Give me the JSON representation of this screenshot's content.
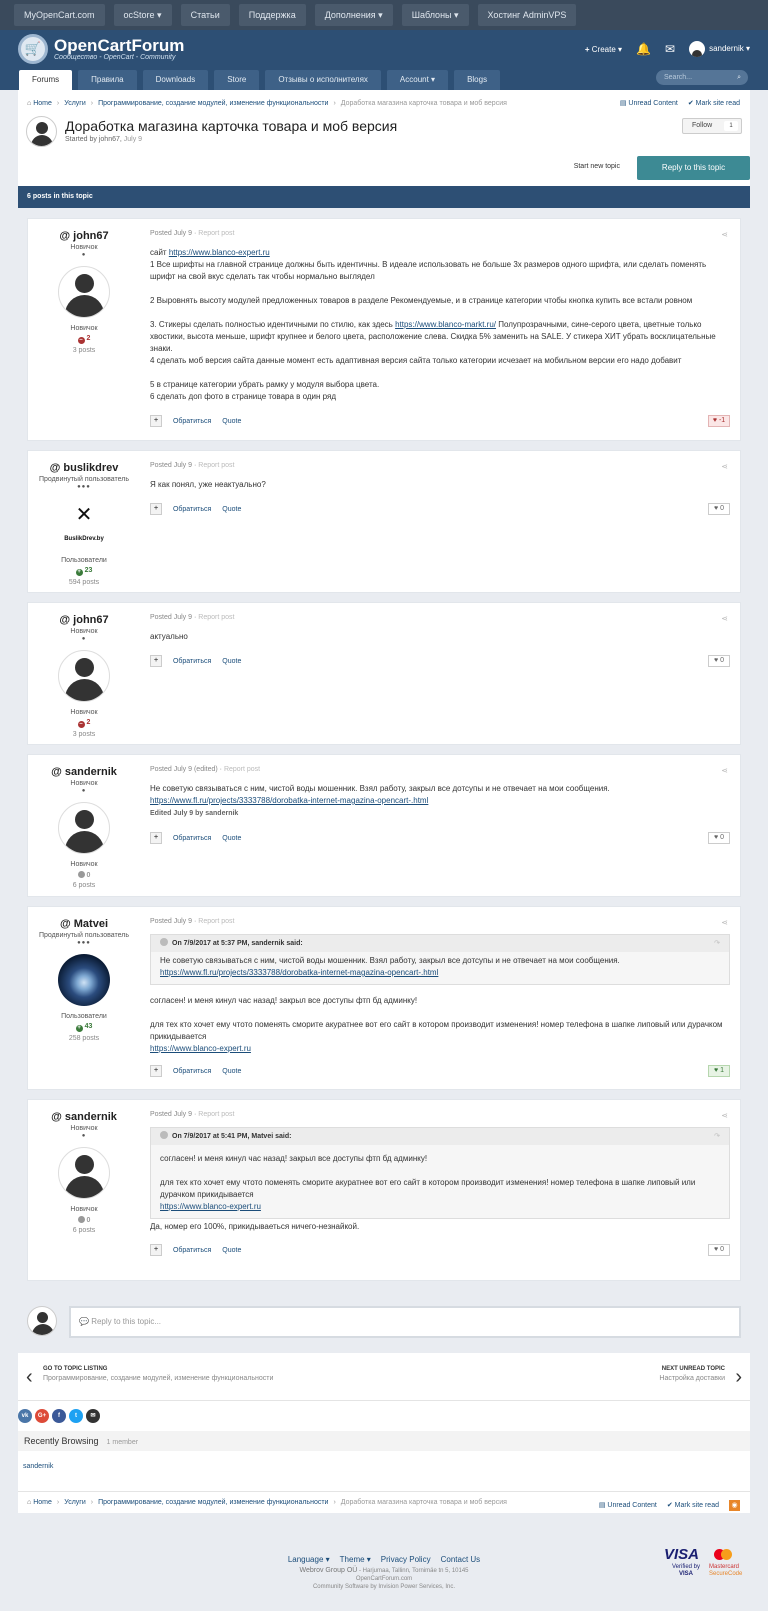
{
  "topnav": [
    "MyOpenCart.com",
    "ocStore ▾",
    "Статьи",
    "Поддержка",
    "Дополнения ▾",
    "Шаблоны ▾",
    "Хостинг AdminVPS"
  ],
  "brand": {
    "name": "OpenCartForum",
    "tagline": "Сообщество - OpenCart - Community"
  },
  "header": {
    "create": "Create",
    "user": "sandernik"
  },
  "mainnav": [
    "Forums",
    "Правила",
    "Downloads",
    "Store",
    "Отзывы о исполнителях",
    "Account ▾",
    "Blogs"
  ],
  "search": {
    "placeholder": "Search..."
  },
  "breadcrumb": {
    "home": "Home",
    "items": [
      "Услуги",
      "Программирование, создание модулей, изменение функциональности"
    ],
    "current": "Доработка магазина карточка товара и моб версия",
    "unread": "Unread Content",
    "mark": "Mark site read"
  },
  "topic": {
    "title": "Доработка магазина карточка товара и моб версия",
    "started_by": "Started by john67,",
    "date": "July 9",
    "follow": "Follow",
    "follow_count": "1",
    "start_new": "Start new topic",
    "reply": "Reply to this topic",
    "posts_count": "6 posts in this topic"
  },
  "labels": {
    "report": "Report post",
    "contact": "Обратиться",
    "quote": "Quote"
  },
  "posts": [
    {
      "user": "john67",
      "rank": "Новичок",
      "pips": "●",
      "group": "Новичок",
      "rep": "2",
      "rep_kind": "neg",
      "posts": "3 posts",
      "meta": "Posted July 9",
      "lines": [
        "сайт ",
        "https://www.blanco-expert.ru",
        "1 Все шрифты на главной странице должны быть идентичны. В идеале использовать не больше 3х размеров одного шрифта, или сделать поменять шрифт на свой вкус сделать так чтобы нормально выглядел",
        "2 Выровнять высоту модулей предложенных товаров в разделе Рекомендуемые, и в странице категории чтобы кнопка купить все встали ровном",
        "3. Стикеры сделать полностью идентичными по стилю, как здесь ",
        "https://www.blanco-markt.ru/",
        " Полупрозрачными, сине-серого цвета, цветные только хвостики, высота меньше, шрифт крупнее и белого цвета, расположение слева. Скидка 5% заменить на SALE. У стикера ХИТ убрать восклицательные знаки.",
        "4 сделать моб версия сайта данные момент есть адаптивная версия сайта только категории исчезает на мобильном версии его надо добавит",
        "5  в странице категории убрать рамку у модуля выбора цвета.",
        "6 сделать доп фото в странице товара в один ряд"
      ],
      "react": "-1"
    },
    {
      "user": "buslikdrev",
      "rank": "Продвинутый пользователь",
      "pips": "●●●",
      "group": "Пользователи",
      "rep": "23",
      "rep_kind": "pos",
      "posts": "594 posts",
      "avatar_text": "BuslikDrev.by",
      "meta": "Posted July 9",
      "text": "Я как понял, уже неактуально?",
      "react": "0"
    },
    {
      "user": "john67",
      "rank": "Новичок",
      "pips": "●",
      "group": "Новичок",
      "rep": "2",
      "rep_kind": "neg",
      "posts": "3 posts",
      "meta": "Posted July 9",
      "text": "актуально",
      "react": "0"
    },
    {
      "user": "sandernik",
      "rank": "Новичок",
      "pips": "●",
      "group": "Новичок",
      "rep": "0",
      "rep_kind": "neu",
      "posts": "6 posts",
      "meta": "Posted July 9 (edited)",
      "text": "Не советую связываться с ним, чистой воды мошенник. Взял работу, закрыл все дотсупы и не отвечает на мои сообщения.",
      "link": "https://www.fl.ru/projects/3333788/dorobatka-internet-magazina-opencart-.html",
      "edited": "Edited July 9 by sandernik",
      "react": "0"
    },
    {
      "user": "Matvei",
      "rank": "Продвинутый пользователь",
      "pips": "●●●",
      "group": "Пользователи",
      "rep": "43",
      "rep_kind": "pos",
      "posts": "258 posts",
      "meta": "Posted July 9",
      "quote_head": "On 7/9/2017 at 5:37 PM, sandernik said:",
      "quote_text": "Не советую связываться с ним, чистой воды мошенник. Взял работу, закрыл все дотсупы и не отвечает на мои сообщения.",
      "quote_link": "https://www.fl.ru/projects/3333788/dorobatka-internet-magazina-opencart-.html",
      "text1": "согласен! и меня кинул час назад! закрыл все доступы фтп бд админку!",
      "text2": "для тех кто хочет ему чтото поменять сморите акуратнее  вот его сайт в котором производит изменения!  номер телефона в шапке липовый или дурачком прикидывается",
      "link": "https://www.blanco-expert.ru",
      "react": "1"
    },
    {
      "user": "sandernik",
      "rank": "Новичок",
      "pips": "●",
      "group": "Новичок",
      "rep": "0",
      "rep_kind": "neu",
      "posts": "6 posts",
      "meta": "Posted July 9",
      "quote_head": "On 7/9/2017 at 5:41 PM, Matvei said:",
      "quote_text1": "согласен! и меня кинул час назад! закрыл все доступы фтп бд админку!",
      "quote_text2": "для тех кто хочет ему чтото поменять сморите акуратнее  вот его сайт в котором производит изменения!  номер телефона в шапке липовый или дурачком прикидывается",
      "quote_link": "https://www.blanco-expert.ru",
      "text": "Да, номер его 100%, прикидываеться ничего-незнайкой.",
      "react": "0"
    }
  ],
  "reply_box": {
    "placeholder": "Reply to this topic..."
  },
  "nav": {
    "prev_head": "GO TO TOPIC LISTING",
    "prev_sub": "Программирование, создание модулей, изменение функциональности",
    "next_head": "NEXT UNREAD TOPIC",
    "next_sub": "Настройка доставки"
  },
  "social": [
    "vk",
    "G+",
    "f",
    "t",
    "✉"
  ],
  "recent": {
    "title": "Recently Browsing",
    "count": "1 member",
    "user": "sandernik"
  },
  "footer": {
    "links": [
      "Language ▾",
      "Theme ▾",
      "Privacy Policy",
      "Contact Us"
    ],
    "company": "Webrov Group OÜ",
    "address": " - Harjumaa, Tallinn, Tornimäe tn 5, 10145",
    "site": "OpenCartForum.com",
    "software": "Community Software by Invision Power Services, Inc.",
    "visa": "VISA",
    "verified": "Verified by",
    "visa2": "VISA",
    "mc1": "Mastercard",
    "mc2": "SecureCode"
  },
  "colors": {
    "header": "#2d4f74",
    "accent": "#3d8a94",
    "topbar": "#3a4a5c"
  }
}
